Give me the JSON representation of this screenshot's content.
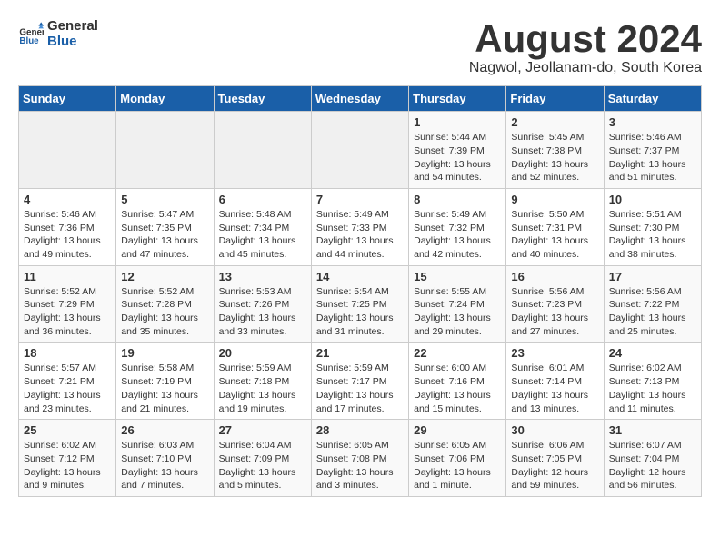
{
  "header": {
    "logo_line1": "General",
    "logo_line2": "Blue",
    "title": "August 2024",
    "subtitle": "Nagwol, Jeollanam-do, South Korea"
  },
  "weekdays": [
    "Sunday",
    "Monday",
    "Tuesday",
    "Wednesday",
    "Thursday",
    "Friday",
    "Saturday"
  ],
  "weeks": [
    [
      {
        "day": "",
        "info": ""
      },
      {
        "day": "",
        "info": ""
      },
      {
        "day": "",
        "info": ""
      },
      {
        "day": "",
        "info": ""
      },
      {
        "day": "1",
        "info": "Sunrise: 5:44 AM\nSunset: 7:39 PM\nDaylight: 13 hours\nand 54 minutes."
      },
      {
        "day": "2",
        "info": "Sunrise: 5:45 AM\nSunset: 7:38 PM\nDaylight: 13 hours\nand 52 minutes."
      },
      {
        "day": "3",
        "info": "Sunrise: 5:46 AM\nSunset: 7:37 PM\nDaylight: 13 hours\nand 51 minutes."
      }
    ],
    [
      {
        "day": "4",
        "info": "Sunrise: 5:46 AM\nSunset: 7:36 PM\nDaylight: 13 hours\nand 49 minutes."
      },
      {
        "day": "5",
        "info": "Sunrise: 5:47 AM\nSunset: 7:35 PM\nDaylight: 13 hours\nand 47 minutes."
      },
      {
        "day": "6",
        "info": "Sunrise: 5:48 AM\nSunset: 7:34 PM\nDaylight: 13 hours\nand 45 minutes."
      },
      {
        "day": "7",
        "info": "Sunrise: 5:49 AM\nSunset: 7:33 PM\nDaylight: 13 hours\nand 44 minutes."
      },
      {
        "day": "8",
        "info": "Sunrise: 5:49 AM\nSunset: 7:32 PM\nDaylight: 13 hours\nand 42 minutes."
      },
      {
        "day": "9",
        "info": "Sunrise: 5:50 AM\nSunset: 7:31 PM\nDaylight: 13 hours\nand 40 minutes."
      },
      {
        "day": "10",
        "info": "Sunrise: 5:51 AM\nSunset: 7:30 PM\nDaylight: 13 hours\nand 38 minutes."
      }
    ],
    [
      {
        "day": "11",
        "info": "Sunrise: 5:52 AM\nSunset: 7:29 PM\nDaylight: 13 hours\nand 36 minutes."
      },
      {
        "day": "12",
        "info": "Sunrise: 5:52 AM\nSunset: 7:28 PM\nDaylight: 13 hours\nand 35 minutes."
      },
      {
        "day": "13",
        "info": "Sunrise: 5:53 AM\nSunset: 7:26 PM\nDaylight: 13 hours\nand 33 minutes."
      },
      {
        "day": "14",
        "info": "Sunrise: 5:54 AM\nSunset: 7:25 PM\nDaylight: 13 hours\nand 31 minutes."
      },
      {
        "day": "15",
        "info": "Sunrise: 5:55 AM\nSunset: 7:24 PM\nDaylight: 13 hours\nand 29 minutes."
      },
      {
        "day": "16",
        "info": "Sunrise: 5:56 AM\nSunset: 7:23 PM\nDaylight: 13 hours\nand 27 minutes."
      },
      {
        "day": "17",
        "info": "Sunrise: 5:56 AM\nSunset: 7:22 PM\nDaylight: 13 hours\nand 25 minutes."
      }
    ],
    [
      {
        "day": "18",
        "info": "Sunrise: 5:57 AM\nSunset: 7:21 PM\nDaylight: 13 hours\nand 23 minutes."
      },
      {
        "day": "19",
        "info": "Sunrise: 5:58 AM\nSunset: 7:19 PM\nDaylight: 13 hours\nand 21 minutes."
      },
      {
        "day": "20",
        "info": "Sunrise: 5:59 AM\nSunset: 7:18 PM\nDaylight: 13 hours\nand 19 minutes."
      },
      {
        "day": "21",
        "info": "Sunrise: 5:59 AM\nSunset: 7:17 PM\nDaylight: 13 hours\nand 17 minutes."
      },
      {
        "day": "22",
        "info": "Sunrise: 6:00 AM\nSunset: 7:16 PM\nDaylight: 13 hours\nand 15 minutes."
      },
      {
        "day": "23",
        "info": "Sunrise: 6:01 AM\nSunset: 7:14 PM\nDaylight: 13 hours\nand 13 minutes."
      },
      {
        "day": "24",
        "info": "Sunrise: 6:02 AM\nSunset: 7:13 PM\nDaylight: 13 hours\nand 11 minutes."
      }
    ],
    [
      {
        "day": "25",
        "info": "Sunrise: 6:02 AM\nSunset: 7:12 PM\nDaylight: 13 hours\nand 9 minutes."
      },
      {
        "day": "26",
        "info": "Sunrise: 6:03 AM\nSunset: 7:10 PM\nDaylight: 13 hours\nand 7 minutes."
      },
      {
        "day": "27",
        "info": "Sunrise: 6:04 AM\nSunset: 7:09 PM\nDaylight: 13 hours\nand 5 minutes."
      },
      {
        "day": "28",
        "info": "Sunrise: 6:05 AM\nSunset: 7:08 PM\nDaylight: 13 hours\nand 3 minutes."
      },
      {
        "day": "29",
        "info": "Sunrise: 6:05 AM\nSunset: 7:06 PM\nDaylight: 13 hours\nand 1 minute."
      },
      {
        "day": "30",
        "info": "Sunrise: 6:06 AM\nSunset: 7:05 PM\nDaylight: 12 hours\nand 59 minutes."
      },
      {
        "day": "31",
        "info": "Sunrise: 6:07 AM\nSunset: 7:04 PM\nDaylight: 12 hours\nand 56 minutes."
      }
    ]
  ]
}
